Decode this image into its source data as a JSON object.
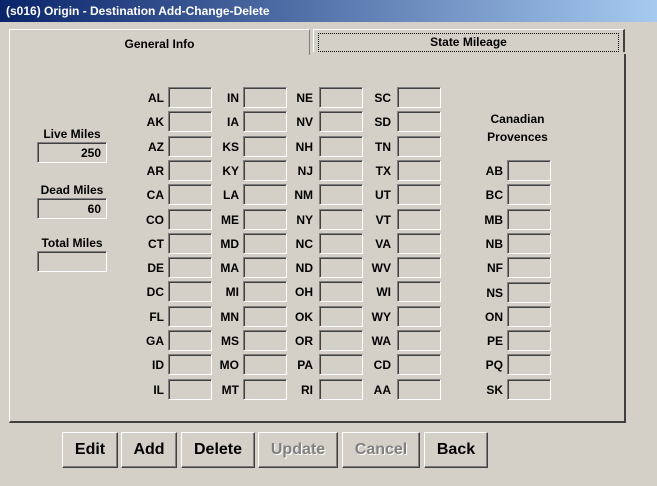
{
  "window": {
    "title": "(s016) Origin - Destination Add-Change-Delete"
  },
  "tabs": {
    "general": "General Info",
    "state": "State Mileage"
  },
  "summary": {
    "live_label": "Live Miles",
    "live_value": "250",
    "dead_label": "Dead Miles",
    "dead_value": "60",
    "total_label": "Total Miles",
    "total_value": ""
  },
  "states": {
    "col1": [
      "AL",
      "AK",
      "AZ",
      "AR",
      "CA",
      "CO",
      "CT",
      "DE",
      "DC",
      "FL",
      "GA",
      "ID",
      "IL"
    ],
    "col2": [
      "IN",
      "IA",
      "KS",
      "KY",
      "LA",
      "ME",
      "MD",
      "MA",
      "MI",
      "MN",
      "MS",
      "MO",
      "MT"
    ],
    "col3": [
      "NE",
      "NV",
      "NH",
      "NJ",
      "NM",
      "NY",
      "NC",
      "ND",
      "OH",
      "OK",
      "OR",
      "PA",
      "RI"
    ],
    "col4": [
      "SC",
      "SD",
      "TN",
      "TX",
      "UT",
      "VT",
      "VA",
      "WV",
      "WI",
      "WY",
      "WA",
      "CD",
      "AA"
    ]
  },
  "canadian": {
    "title_line1": "Canadian",
    "title_line2": "Provences",
    "provinces": [
      "AB",
      "BC",
      "MB",
      "NB",
      "NF",
      "NS",
      "ON",
      "PE",
      "PQ",
      "SK"
    ]
  },
  "buttons": {
    "edit": "Edit",
    "add": "Add",
    "delete": "Delete",
    "update": "Update",
    "cancel": "Cancel",
    "back": "Back"
  }
}
